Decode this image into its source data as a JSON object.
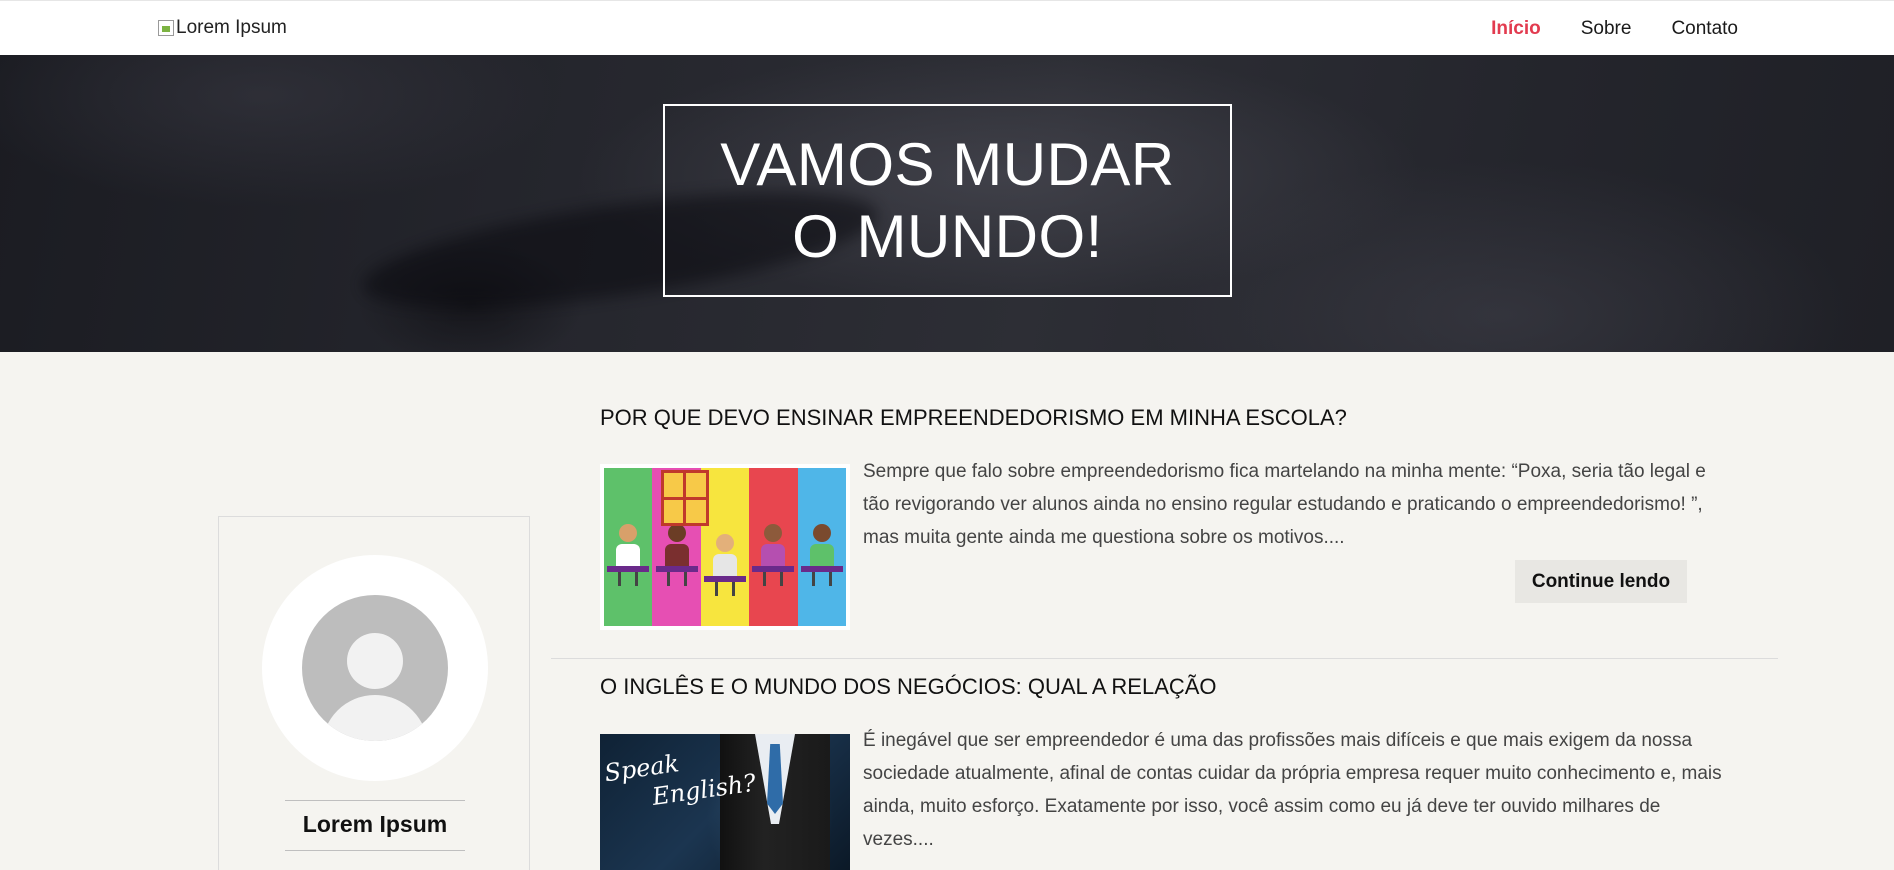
{
  "header": {
    "logo_alt": "Lorem Ipsum",
    "nav": [
      {
        "label": "Início",
        "active": true
      },
      {
        "label": "Sobre",
        "active": false
      },
      {
        "label": "Contato",
        "active": false
      }
    ],
    "active_color": "#e23b4f"
  },
  "hero": {
    "title": "VAMOS MUDAR O MUNDO!"
  },
  "sidebar": {
    "profile_name": "Lorem Ipsum"
  },
  "posts": [
    {
      "title": "POR QUE DEVO ENSINAR EMPREENDEDORISMO EM MINHA ESCOLA?",
      "excerpt": "Sempre que falo sobre empreendedorismo fica martelando na minha mente: “Poxa, seria tão legal e tão revigorando ver alunos ainda no ensino regular estudando e praticando o empreendedorismo! ”, mas muita gente ainda me questiona sobre os motivos....",
      "button": "Continue lendo"
    },
    {
      "title": "O INGLÊS E O MUNDO DOS NEGÓCIOS: QUAL A RELAÇÃO",
      "excerpt": "É inegável que ser empreendedor é uma das profissões mais difíceis e que mais exigem da nossa sociedade atualmente, afinal de contas cuidar da própria empresa requer muito conhecimento e, mais ainda, muito esforço. Exatamente por isso, você assim como eu já deve ter ouvido milhares de vezes....",
      "image_text": [
        "Speak",
        "English?"
      ]
    }
  ]
}
